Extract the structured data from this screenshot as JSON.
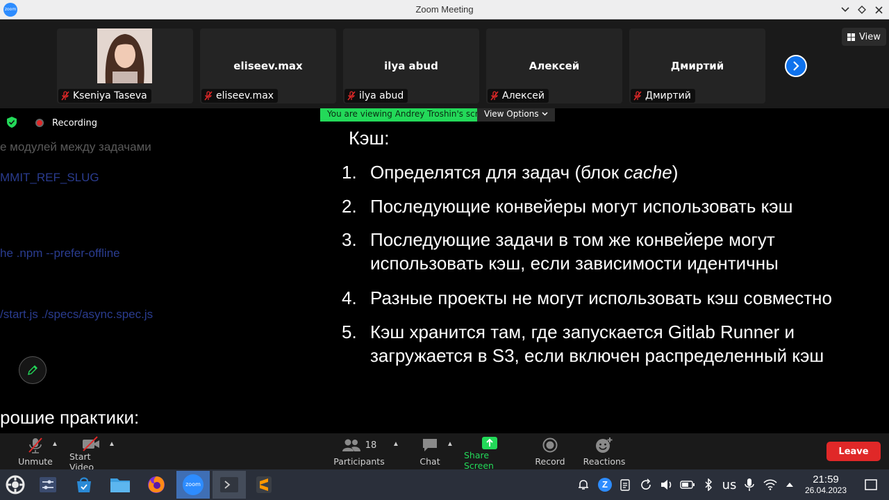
{
  "window": {
    "title": "Zoom Meeting",
    "logo_text": "zoom"
  },
  "gallery": {
    "participants": [
      {
        "name": "Kseniya Taseva",
        "display": "",
        "has_photo": true
      },
      {
        "name": "eliseev.max",
        "display": "eliseev.max"
      },
      {
        "name": "ilya abud",
        "display": "ilya abud"
      },
      {
        "name": "Алексей",
        "display": "Алексей"
      },
      {
        "name": "Дмиртий",
        "display": "Дмиртий"
      }
    ],
    "view_label": "View"
  },
  "share": {
    "banner": "You are viewing Andrey Troshin's screen",
    "view_options": "View Options",
    "recording_label": "Recording",
    "left_fragments": [
      "е модулей между задачами",
      "MMIT_REF_SLUG",
      "he .npm --prefer-offline",
      "/start.js ./specs/async.spec.js"
    ],
    "bottom_heading": "рошие практики:",
    "slide": {
      "title": "Кэш:",
      "items": [
        {
          "num": "1.",
          "pre": "Определятся для задач (блок ",
          "em": "cache",
          "post": ")"
        },
        {
          "num": "2.",
          "line1": "Последующие конвейеры могут использовать кэш"
        },
        {
          "num": "3.",
          "line1": "Последующие задачи в том же конвейере могут",
          "line2": "использовать кэш, если зависимости идентичны"
        },
        {
          "num": "4.",
          "line1": "Разные проекты не могут использовать кэш совместно"
        },
        {
          "num": "5.",
          "line1": "Кэш хранится там, где запускается Gitlab Runner и",
          "line2": "загружается в S3, если включен распределенный кэш"
        }
      ]
    }
  },
  "toolbar": {
    "unmute": "Unmute",
    "start_video": "Start Video",
    "participants": "Participants",
    "participants_count": "18",
    "chat": "Chat",
    "share_screen": "Share Screen",
    "record": "Record",
    "reactions": "Reactions",
    "leave": "Leave"
  },
  "taskbar": {
    "zoom_label": "zoom",
    "keyboard_layout": "us",
    "time": "21:59",
    "date": "26.04.2023"
  },
  "colors": {
    "accent": "#0e72ed",
    "banner": "#23d959",
    "leave": "#e02828",
    "share_icon": "#23d959"
  }
}
